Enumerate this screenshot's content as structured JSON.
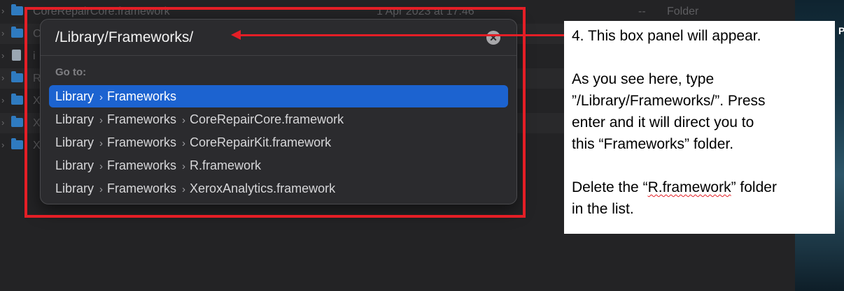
{
  "finder": {
    "rows": [
      {
        "name": "CoreRepairCore.framework",
        "date": "1 Apr 2023 at 17:46",
        "size": "--",
        "kind": "Folder",
        "icon": "folder-icon"
      },
      {
        "name": "C",
        "date": "",
        "size": "",
        "kind": "",
        "icon": "folder-icon"
      },
      {
        "name": "i",
        "date": "",
        "size": "",
        "kind": "",
        "icon": "document-icon"
      },
      {
        "name": "R",
        "date": "",
        "size": "",
        "kind": "",
        "icon": "folder-icon"
      },
      {
        "name": "X",
        "date": "",
        "size": "",
        "kind": "",
        "icon": "folder-icon"
      },
      {
        "name": "X",
        "date": "",
        "size": "",
        "kind": "",
        "icon": "folder-icon"
      },
      {
        "name": "X",
        "date": "",
        "size": "",
        "kind": "",
        "icon": "folder-icon"
      }
    ],
    "right_edge_char": "P"
  },
  "goto": {
    "input_value": "/Library/Frameworks/",
    "clear_icon": "xmark-circle-icon",
    "clear_glyph": "✕",
    "section_label": "Go to:",
    "separator_glyph": "›",
    "results": [
      {
        "segments": [
          "Library",
          "Frameworks"
        ],
        "selected": true
      },
      {
        "segments": [
          "Library",
          "Frameworks",
          "CoreRepairCore.framework"
        ],
        "selected": false
      },
      {
        "segments": [
          "Library",
          "Frameworks",
          "CoreRepairKit.framework"
        ],
        "selected": false
      },
      {
        "segments": [
          "Library",
          "Frameworks",
          "R.framework"
        ],
        "selected": false
      },
      {
        "segments": [
          "Library",
          "Frameworks",
          "XeroxAnalytics.framework"
        ],
        "selected": false
      }
    ]
  },
  "annotation": {
    "frame_color": "#e41e26",
    "step": "4. This box panel will appear.",
    "para2_line1": "As you see here, type",
    "para2_line2": "”/Library/Frameworks/”. Press",
    "para2_line3": "enter and it will direct you to",
    "para2_line4": "this “Frameworks” folder.",
    "para3_pre": "Delete the “",
    "para3_word": "R.framework",
    "para3_post": "” folder",
    "para3_line2": "in the list."
  },
  "colors": {
    "selection": "#1c63d0",
    "folder": "#2f7bc0"
  }
}
